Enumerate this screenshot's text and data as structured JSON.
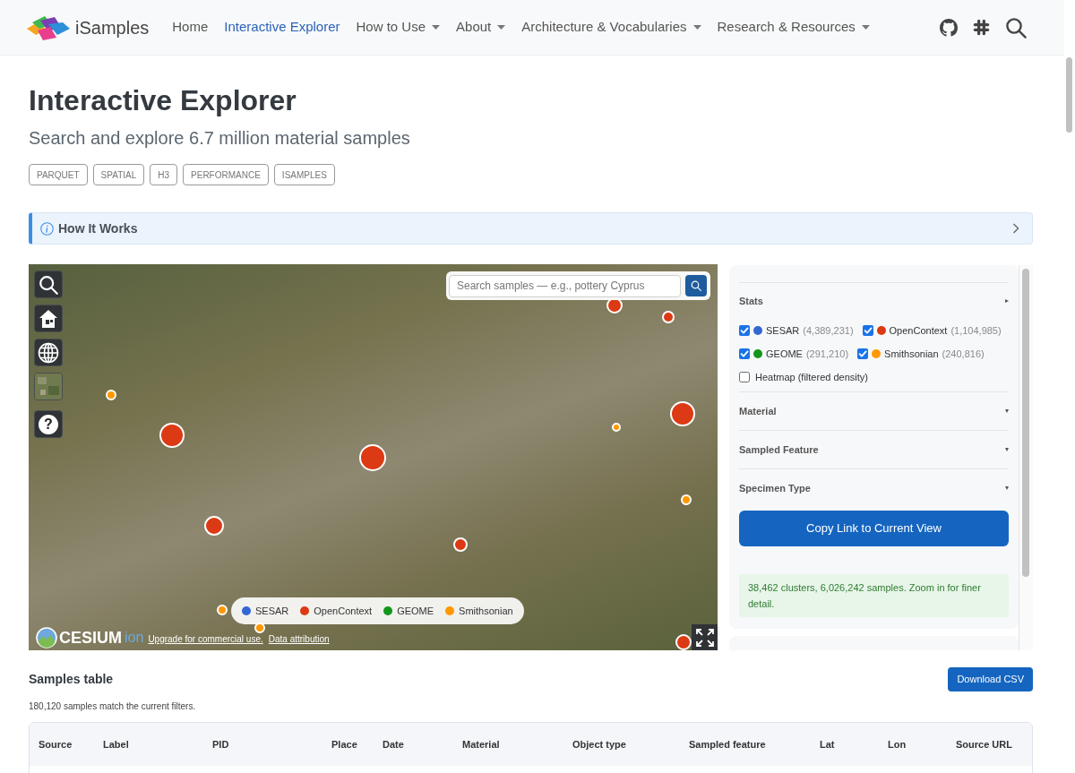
{
  "nav": {
    "brand": "iSamples",
    "links": [
      {
        "label": "Home",
        "selected": false,
        "dropdown": false
      },
      {
        "label": "Interactive Explorer",
        "selected": true,
        "dropdown": false
      },
      {
        "label": "How to Use",
        "selected": false,
        "dropdown": true
      },
      {
        "label": "About",
        "selected": false,
        "dropdown": true
      },
      {
        "label": "Architecture & Vocabularies",
        "selected": false,
        "dropdown": true
      },
      {
        "label": "Research & Resources",
        "selected": false,
        "dropdown": true
      }
    ]
  },
  "header": {
    "title": "Interactive Explorer",
    "subtitle": "Search and explore 6.7 million material samples",
    "tags": [
      "PARQUET",
      "SPATIAL",
      "H3",
      "PERFORMANCE",
      "ISAMPLES"
    ]
  },
  "callout": {
    "title": "How It Works",
    "expanded": false
  },
  "map": {
    "search": {
      "placeholder": "Search samples — e.g., pottery Cyprus"
    },
    "help_label": "?",
    "legend": [
      {
        "label": "SESAR",
        "color": "#3566d6"
      },
      {
        "label": "OpenContext",
        "color": "#dc3a14"
      },
      {
        "label": "GEOME",
        "color": "#13961a"
      },
      {
        "label": "Smithsonian",
        "color": "#ff9800"
      }
    ],
    "credit": {
      "logo_text": "CESIUM",
      "logo_suffix": "ion",
      "links": [
        "Upgrade for commercial use.",
        "Data attribution"
      ]
    }
  },
  "filters": {
    "sections": [
      {
        "title": "Stats",
        "toggle": "▸",
        "sources": [
          {
            "name": "SESAR",
            "count": "(4,389,231)",
            "checked": true,
            "color": "#3566d6"
          },
          {
            "name": "OpenContext",
            "count": "(1,104,985)",
            "checked": true,
            "color": "#dc3a14"
          },
          {
            "name": "GEOME",
            "count": "(291,210)",
            "checked": true,
            "color": "#13961a"
          },
          {
            "name": "Smithsonian",
            "count": "(240,816)",
            "checked": true,
            "color": "#ff9800"
          }
        ],
        "options": [
          {
            "label": "Heatmap (filtered density)",
            "checked": false
          }
        ]
      },
      {
        "title": "Material",
        "toggle": "▾"
      },
      {
        "title": "Sampled Feature",
        "toggle": "▾"
      },
      {
        "title": "Specimen Type",
        "toggle": "▾"
      }
    ],
    "copy_button": "Copy Link to Current View",
    "status": "38,462 clusters, 6,026,242 samples. Zoom in for finer detail."
  },
  "table": {
    "title": "Samples table",
    "download_button": "Download CSV",
    "summary": "180,120 samples match the current filters.",
    "columns": [
      "Source",
      "Label",
      "PID",
      "Place",
      "Date",
      "Material",
      "Object type",
      "Sampled feature",
      "Lat",
      "Lon",
      "Source URL"
    ]
  }
}
